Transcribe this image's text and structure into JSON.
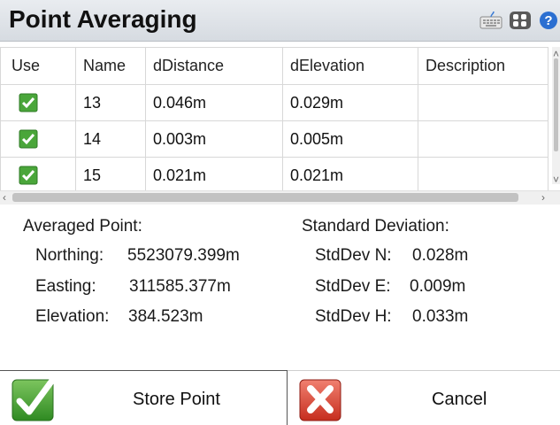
{
  "window": {
    "title": "Point Averaging"
  },
  "toolbar": {
    "icons": [
      "keyboard-icon",
      "grid-icon",
      "help-icon"
    ]
  },
  "table": {
    "columns": [
      "Use",
      "Name",
      "dDistance",
      "dElevation",
      "Description"
    ],
    "rows": [
      {
        "use": true,
        "name": "13",
        "dDistance": "0.046m",
        "dElevation": "0.029m",
        "description": ""
      },
      {
        "use": true,
        "name": "14",
        "dDistance": "0.003m",
        "dElevation": "0.005m",
        "description": ""
      },
      {
        "use": true,
        "name": "15",
        "dDistance": "0.021m",
        "dElevation": "0.021m",
        "description": ""
      }
    ]
  },
  "averaged": {
    "heading": "Averaged Point:",
    "northing_label": "Northing:",
    "northing_value": "5523079.399m",
    "easting_label": "Easting:",
    "easting_value": "311585.377m",
    "elevation_label": "Elevation:",
    "elevation_value": "384.523m"
  },
  "stddev": {
    "heading": "Standard Deviation:",
    "n_label": "StdDev N:",
    "n_value": "0.028m",
    "e_label": "StdDev E:",
    "e_value": "0.009m",
    "h_label": "StdDev H:",
    "h_value": "0.033m"
  },
  "buttons": {
    "store": "Store Point",
    "cancel": "Cancel"
  },
  "colors": {
    "check": "#3c9a2e",
    "cancel_red": "#d63a2a",
    "titlebar": "#dde1e6"
  }
}
